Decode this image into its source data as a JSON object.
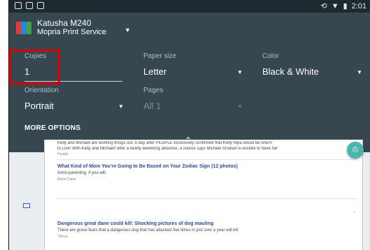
{
  "status_bar": {
    "time": "2:01"
  },
  "printer": {
    "name": "Katusha M240",
    "service": "Mopria Print Service"
  },
  "settings": {
    "copies": {
      "label": "Copies",
      "value": "1"
    },
    "paper_size": {
      "label": "Paper size",
      "value": "Letter"
    },
    "color": {
      "label": "Color",
      "value": "Black & White"
    },
    "orientation": {
      "label": "Orientation",
      "value": "Portrait"
    },
    "pages": {
      "label": "Pages",
      "value": "All 1"
    }
  },
  "more_options_label": "MORE OPTIONS",
  "preview": {
    "story1_text": "Kelly and Michael are working things out. A day after PEOPLE exclusively confirmed that Kelly Ripa would be return",
    "story1_text2": "to Live! With Kelly and Michael! after a nearly weeklong absence, a source says Michael Strahan is excited to have her",
    "story1_src": "People",
    "story2_title": "What Kind of Mom You're Going to Be Based on Your Zodiac Sign (12 photos)",
    "story2_text": "Astro-parenting, if you will.",
    "story2_src": "Marie Claire",
    "story3_title": "Dangerous great dane could kill: Shocking pictures of dog mauling",
    "story3_text": "There are grave fears that a dangerous dog that has attacked five times in just over a year will kill.",
    "story3_src": "7News"
  },
  "accent_colors": {
    "panel": "#37474f",
    "fab": "#4db6ac",
    "highlight": "#e00000"
  }
}
